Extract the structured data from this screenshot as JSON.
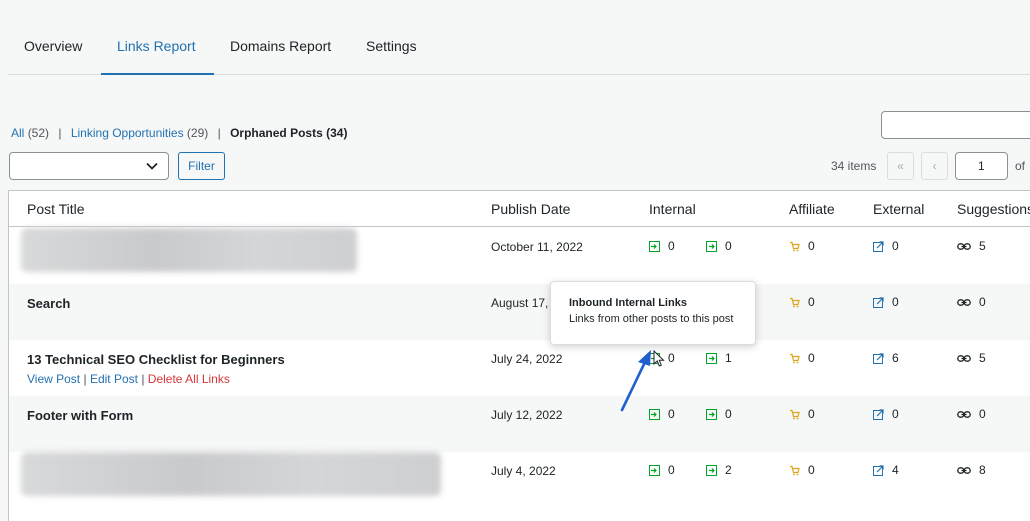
{
  "tabs": [
    {
      "label": "Overview"
    },
    {
      "label": "Links Report"
    },
    {
      "label": "Domains Report"
    },
    {
      "label": "Settings"
    }
  ],
  "filters": {
    "all_label": "All",
    "all_count": "(52)",
    "linking_label": "Linking Opportunities",
    "linking_count": "(29)",
    "orphaned_label": "Orphaned Posts (34)",
    "sep": "|"
  },
  "toolbar": {
    "filter_label": "Filter",
    "items": "34 items",
    "first_page": "«",
    "prev_page": "‹",
    "current_page": "1",
    "of": "of"
  },
  "columns": {
    "title": "Post Title",
    "date": "Publish Date",
    "internal": "Internal",
    "affiliate": "Affiliate",
    "external": "External",
    "suggestions": "Suggestions"
  },
  "rows": [
    {
      "title": "",
      "date": "October 11, 2022",
      "inbound": "0",
      "outbound": "0",
      "affiliate": "0",
      "external": "0",
      "suggestions": "5"
    },
    {
      "title": "Search",
      "date": "August 17,",
      "inbound": "",
      "outbound": "",
      "affiliate": "0",
      "external": "0",
      "suggestions": "0"
    },
    {
      "title": "13 Technical SEO Checklist for Beginners",
      "date": "July 24, 2022",
      "inbound": "0",
      "outbound": "1",
      "affiliate": "0",
      "external": "6",
      "suggestions": "5"
    },
    {
      "title": "Footer with Form",
      "date": "July 12, 2022",
      "inbound": "0",
      "outbound": "0",
      "affiliate": "0",
      "external": "0",
      "suggestions": "0"
    },
    {
      "title": "",
      "date": "July 4, 2022",
      "inbound": "0",
      "outbound": "2",
      "affiliate": "0",
      "external": "4",
      "suggestions": "8"
    }
  ],
  "row_actions": {
    "view": "View Post",
    "edit": "Edit Post",
    "delete": "Delete All Links",
    "sep": "|"
  },
  "tooltip": {
    "title": "Inbound Internal Links",
    "body": "Links from other posts to this post"
  },
  "colors": {
    "accent": "#2271b1",
    "internal_icon": "#00a32a",
    "affiliate_icon": "#dba617",
    "external_icon": "#2271b1",
    "delete": "#d63638"
  }
}
